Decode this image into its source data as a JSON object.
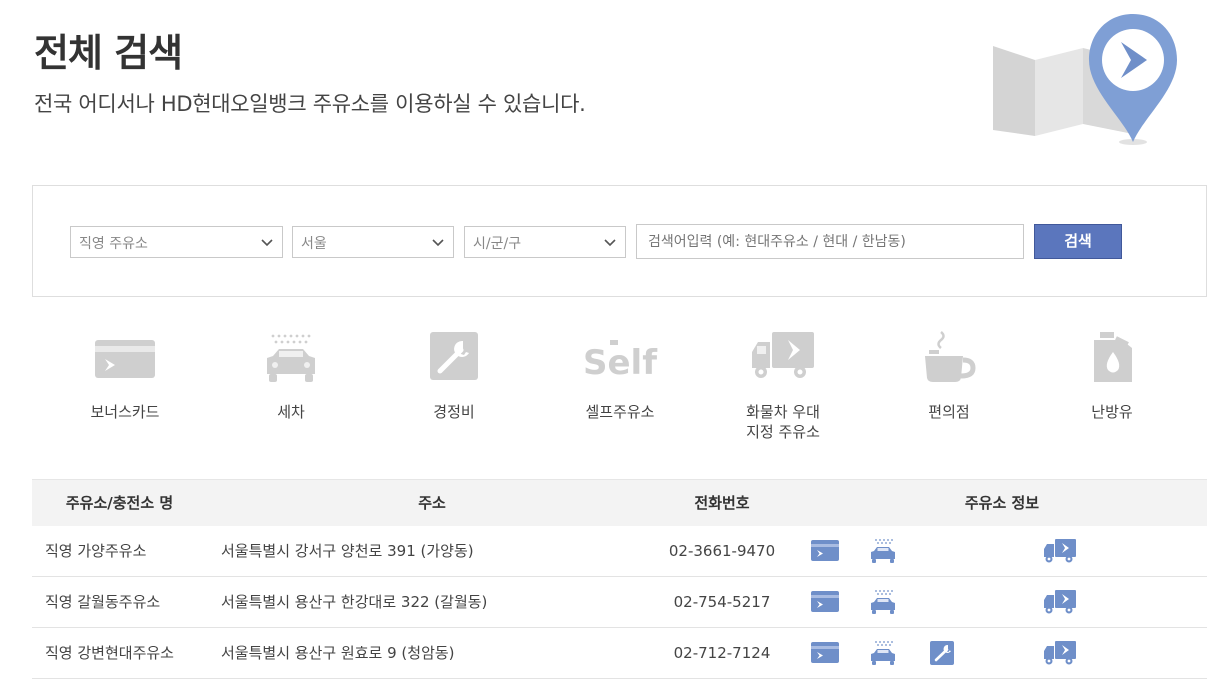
{
  "header": {
    "title": "전체 검색",
    "subtitle": "전국 어디서나 HD현대오일뱅크 주유소를 이용하실 수 있습니다."
  },
  "search": {
    "type_selected": "직영 주유소",
    "city_selected": "서울",
    "district_selected": "시/군/구",
    "placeholder": "검색어입력 (예: 현대주유소 / 현대 / 한남동)",
    "button_label": "검색"
  },
  "filters": [
    {
      "label": "보너스카드",
      "icon": "bonus-card-icon"
    },
    {
      "label": "세차",
      "icon": "car-wash-icon"
    },
    {
      "label": "경정비",
      "icon": "wrench-icon"
    },
    {
      "label": "셀프주유소",
      "icon": "self-icon"
    },
    {
      "label": "화물차 우대\n지정 주유소",
      "icon": "truck-icon"
    },
    {
      "label": "편의점",
      "icon": "coffee-cup-icon"
    },
    {
      "label": "난방유",
      "icon": "oil-can-icon"
    }
  ],
  "table": {
    "headers": {
      "name": "주유소/충전소 명",
      "address": "주소",
      "phone": "전화번호",
      "info": "주유소 정보"
    },
    "rows": [
      {
        "name": "직영 가양주유소",
        "address": "서울특별시 강서구 양천로 391 (가양동)",
        "phone": "02-3661-9470",
        "services": [
          "bonus-card-icon",
          "car-wash-icon",
          "truck-icon"
        ]
      },
      {
        "name": "직영 갈월동주유소",
        "address": "서울특별시 용산구 한강대로 322 (갈월동)",
        "phone": "02-754-5217",
        "services": [
          "bonus-card-icon",
          "car-wash-icon",
          "truck-icon"
        ]
      },
      {
        "name": "직영 강변현대주유소",
        "address": "서울특별시 용산구 원효로 9 (청암동)",
        "phone": "02-712-7124",
        "services": [
          "bonus-card-icon",
          "car-wash-icon",
          "wrench-icon",
          "truck-icon"
        ]
      }
    ]
  },
  "colors": {
    "accent": "#5b76bd",
    "icon_gray": "#cccccc",
    "icon_blue": "#6f8fc9"
  }
}
